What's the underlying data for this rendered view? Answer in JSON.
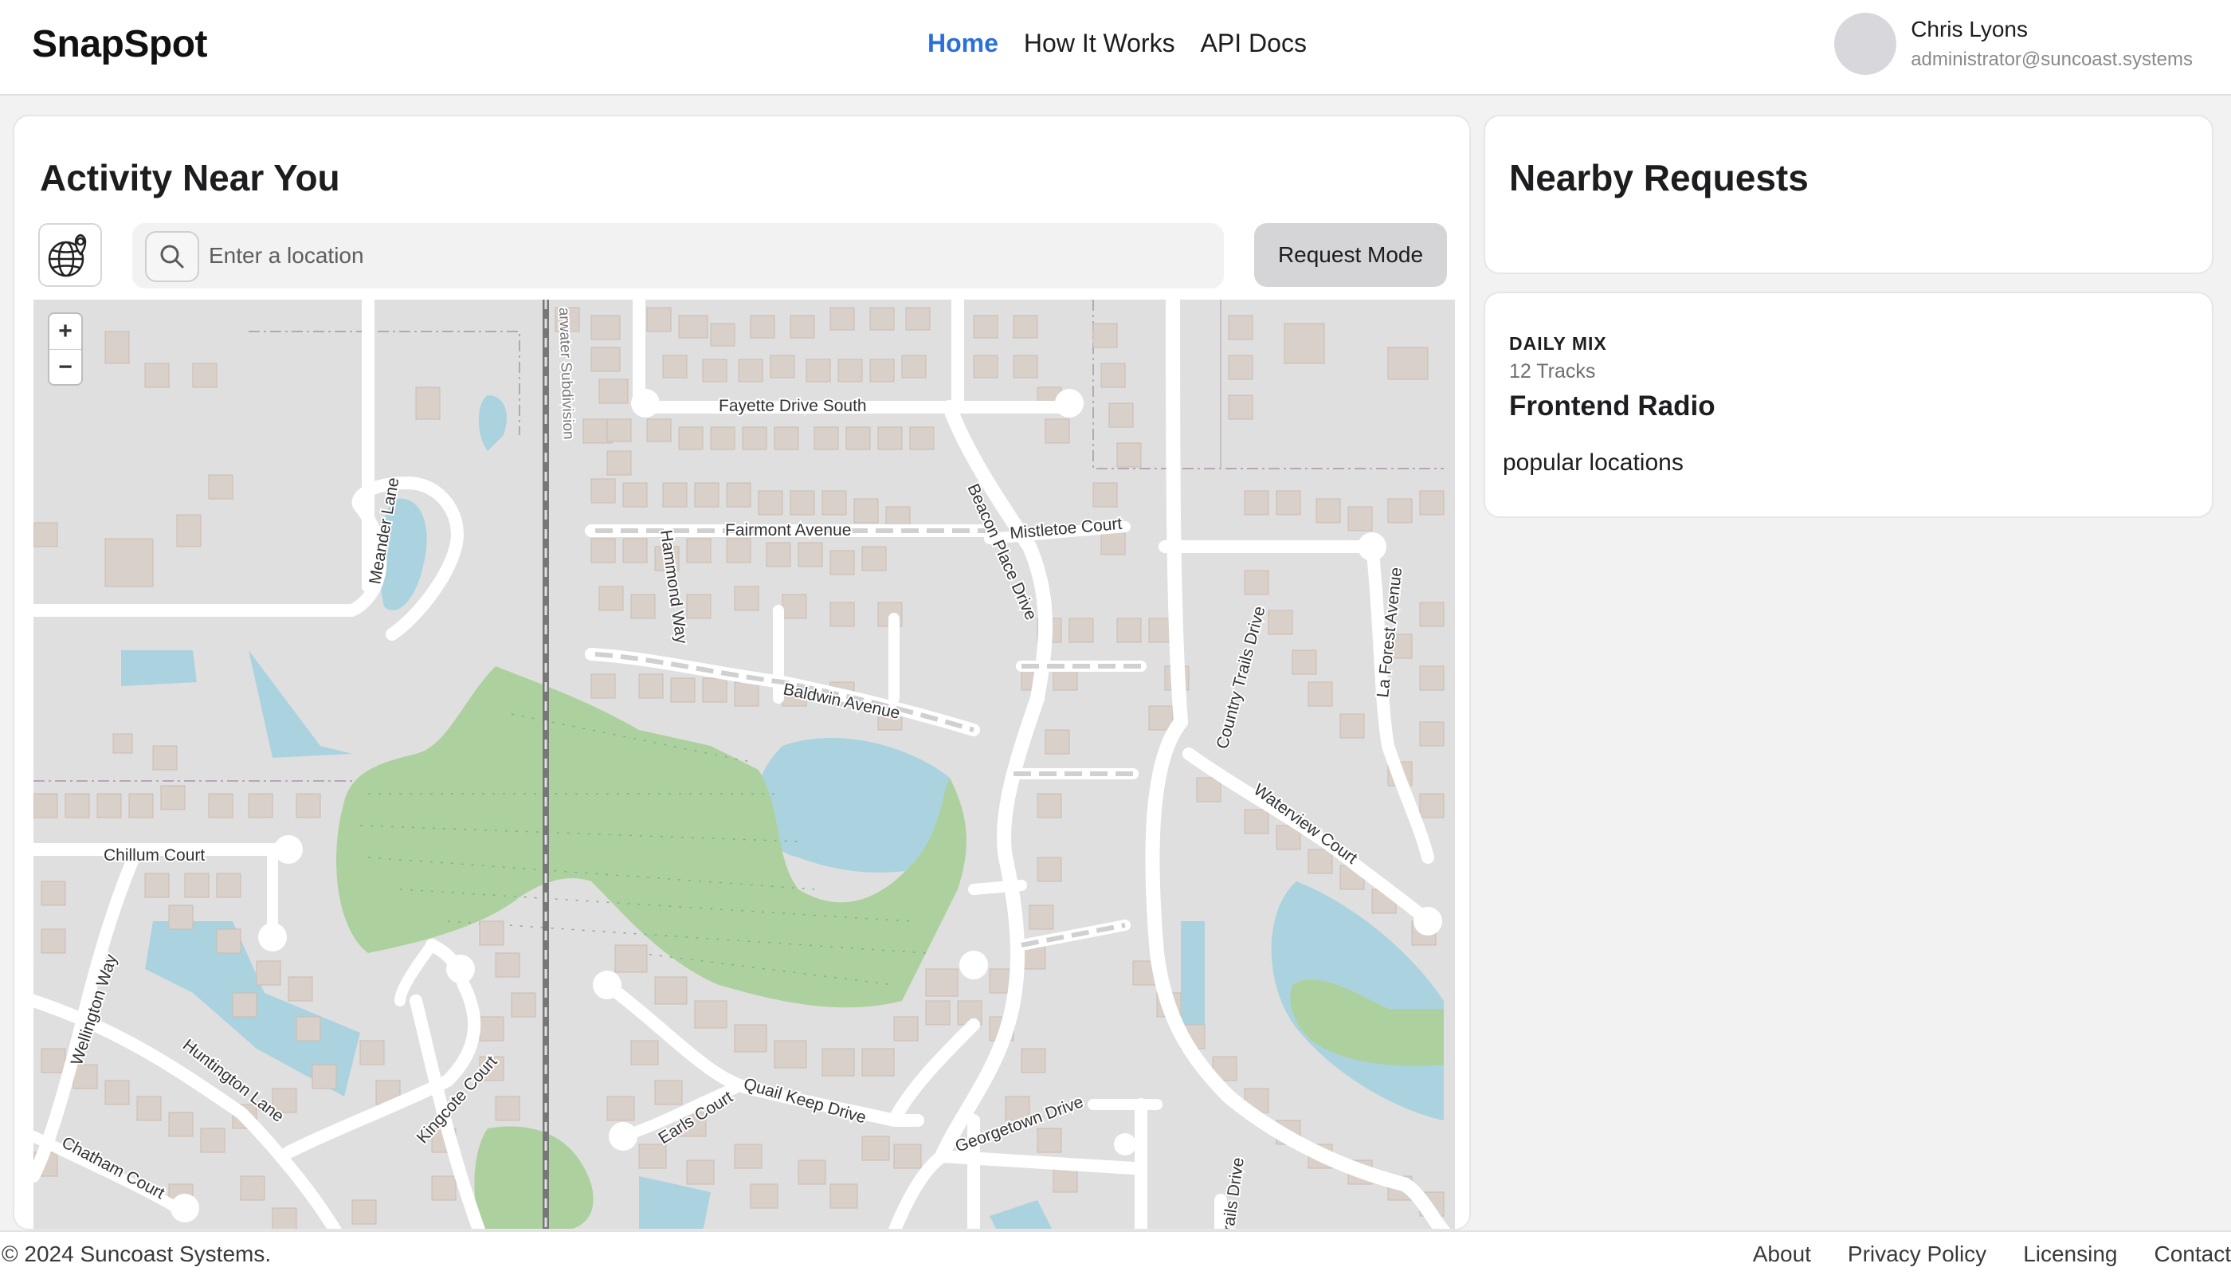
{
  "app": {
    "name": "SnapSpot"
  },
  "nav": {
    "items": [
      "Home",
      "How It Works",
      "API Docs"
    ],
    "active": "Home"
  },
  "user": {
    "name": "Chris Lyons",
    "email": "administrator@suncoast.systems"
  },
  "main": {
    "title": "Activity Near You",
    "search": {
      "placeholder": "Enter a location",
      "value": ""
    },
    "request_mode_label": "Request Mode",
    "zoom_in": "+",
    "zoom_out": "−"
  },
  "map": {
    "streets": {
      "fayette": "Fayette Drive South",
      "fairmont": "Fairmont Avenue",
      "mistletoe": "Mistletoe Court",
      "beacon": "Beacon Place Drive",
      "hammond": "Hammond Way",
      "baldwin": "Baldwin Avenue",
      "meander": "Meander Lane",
      "country_trails": "Country Trails Drive",
      "la_forest": "La Forest Avenue",
      "waterview": "Waterview Court",
      "chillum": "Chillum Court",
      "wellington": "Wellington Way",
      "huntington": "Huntington Lane",
      "kingcote": "Kingcote Court",
      "chatham": "Chatham Court",
      "quail_keep": "Quail Keep Drive",
      "earls": "Earls Court",
      "georgetown": "Georgetown Drive",
      "trails_drive": "rails Drive",
      "subdivision": "arwater Subdivision"
    },
    "colors": {
      "land": "#e0dfdf",
      "road": "#ffffff",
      "building": "#d9d0c9",
      "water": "#aad3df",
      "wood": "#add19e"
    }
  },
  "sidebar": {
    "title": "Nearby Requests",
    "card": {
      "label": "DAILY MIX",
      "tracks": "12 Tracks",
      "title": "Frontend Radio",
      "description": "popular locations"
    }
  },
  "footer": {
    "copyright": "© 2024 Suncoast Systems.",
    "links": [
      "About",
      "Privacy Policy",
      "Licensing",
      "Contact"
    ]
  },
  "icons": {
    "logo_button": "globe-pin-icon",
    "search": "search-icon"
  }
}
